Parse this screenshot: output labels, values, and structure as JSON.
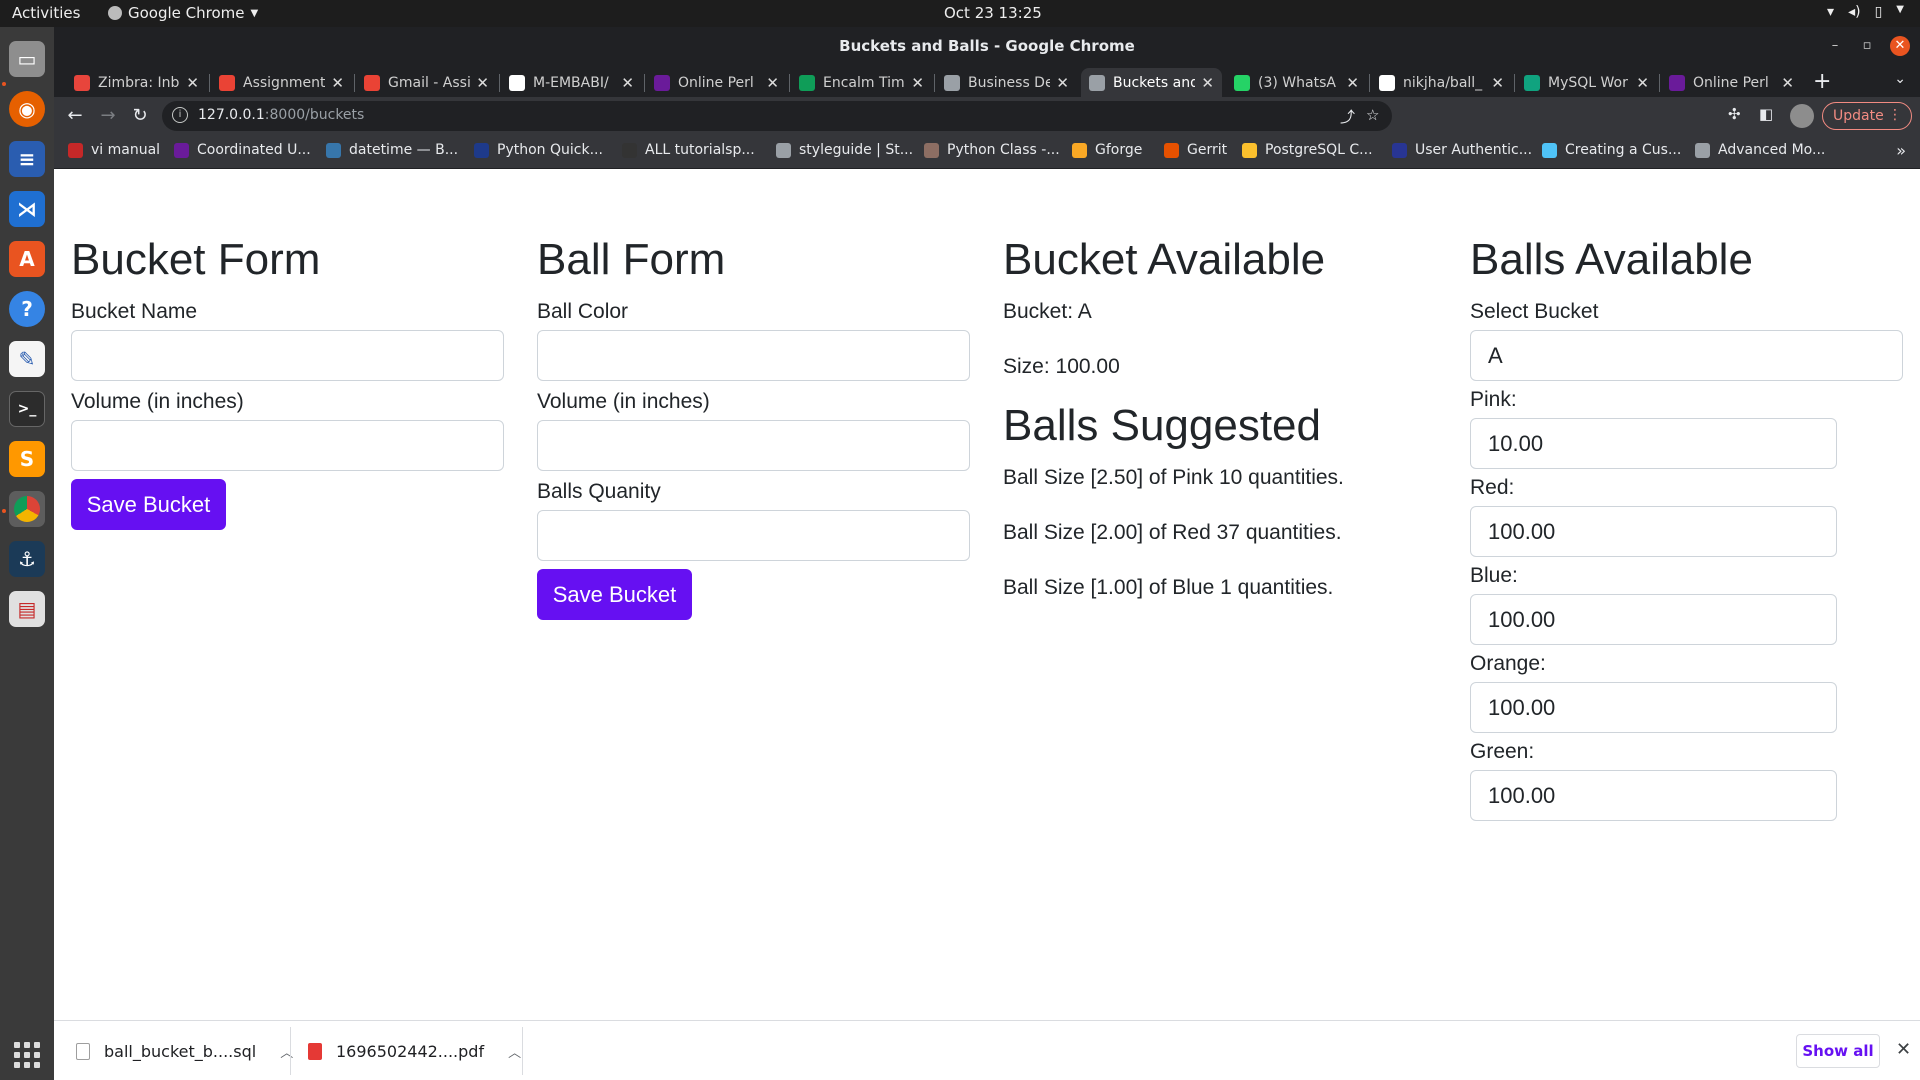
{
  "os": {
    "activities": "Activities",
    "app_menu": "Google Chrome",
    "clock": "Oct 23  13:25"
  },
  "window": {
    "title": "Buckets and Balls - Google Chrome"
  },
  "tabs": [
    {
      "label": "Zimbra: Inb",
      "icon": "zimbra-icon",
      "color": "#e8453c"
    },
    {
      "label": "Assignment",
      "icon": "gmail-icon",
      "color": "#ea4335"
    },
    {
      "label": "Gmail - Assi",
      "icon": "gmail-icon",
      "color": "#ea4335"
    },
    {
      "label": "M-EMBABI/",
      "icon": "github-icon",
      "color": "#ffffff"
    },
    {
      "label": "Online Perl",
      "icon": "onecompiler-icon",
      "color": "#6a1b9a"
    },
    {
      "label": "Encalm Tim",
      "icon": "sheets-icon",
      "color": "#0f9d58"
    },
    {
      "label": "Business De",
      "icon": "globe-icon",
      "color": "#9aa0a6"
    },
    {
      "label": "Buckets and",
      "icon": "globe-icon",
      "color": "#9aa0a6",
      "active": true
    },
    {
      "label": "(3) WhatsA",
      "icon": "whatsapp-icon",
      "color": "#25d366"
    },
    {
      "label": "nikjha/ball_",
      "icon": "github-icon",
      "color": "#ffffff"
    },
    {
      "label": "MySQL Wor",
      "icon": "chatgpt-icon",
      "color": "#10a37f"
    },
    {
      "label": "Online Perl",
      "icon": "onecompiler-icon",
      "color": "#6a1b9a"
    }
  ],
  "address_bar": {
    "host": "127.0.0.1",
    "path": ":8000/buckets"
  },
  "update_label": "Update",
  "bookmarks": [
    {
      "label": "vi manual",
      "icon": "bookmark-s-icon",
      "color": "#c62828"
    },
    {
      "label": "Coordinated U...",
      "icon": "bookmark-cu-icon",
      "color": "#6a1b9a"
    },
    {
      "label": "datetime — B...",
      "icon": "python-icon",
      "color": "#3776ab"
    },
    {
      "label": "Python Quick...",
      "icon": "bookmark-play-icon",
      "color": "#1e3a8a"
    },
    {
      "label": "ALL tutorialsp...",
      "icon": "bookmark-grid-icon",
      "color": "#333333"
    },
    {
      "label": "styleguide | St...",
      "icon": "globe-icon",
      "color": "#9aa0a6"
    },
    {
      "label": "Python Class -...",
      "icon": "bookmark-w3-icon",
      "color": "#8d6e63"
    },
    {
      "label": "Gforge",
      "icon": "gforge-icon",
      "color": "#f9a825"
    },
    {
      "label": "Gerrit",
      "icon": "gerrit-icon",
      "color": "#e65100"
    },
    {
      "label": "PostgreSQL C...",
      "icon": "postgresql-icon",
      "color": "#fbc02d"
    },
    {
      "label": "User Authentic...",
      "icon": "bookmark-user-icon",
      "color": "#283593"
    },
    {
      "label": "Creating a Cus...",
      "icon": "bookmark-cube-icon",
      "color": "#4fc3f7"
    },
    {
      "label": "Advanced Mo...",
      "icon": "globe-icon",
      "color": "#9aa0a6"
    }
  ],
  "bucket_form": {
    "title": "Bucket Form",
    "name_label": "Bucket Name",
    "volume_label": "Volume (in inches)",
    "save_label": "Save Bucket"
  },
  "ball_form": {
    "title": "Ball Form",
    "color_label": "Ball Color",
    "volume_label": "Volume (in inches)",
    "quantity_label": "Balls Quanity",
    "save_label": "Save Bucket"
  },
  "bucket_available": {
    "title": "Bucket Available",
    "bucket_line": "Bucket: A",
    "size_line": "Size: 100.00"
  },
  "balls_suggested": {
    "title": "Balls Suggested",
    "lines": [
      "Ball Size [2.50] of Pink 10 quantities.",
      "Ball Size [2.00] of Red 37 quantities.",
      "Ball Size [1.00] of Blue 1 quantities."
    ]
  },
  "balls_available": {
    "title": "Balls Available",
    "select_label": "Select Bucket",
    "selected_bucket": "A",
    "colors": [
      {
        "label": "Pink:",
        "value": "10.00"
      },
      {
        "label": "Red:",
        "value": "100.00"
      },
      {
        "label": "Blue:",
        "value": "100.00"
      },
      {
        "label": "Orange:",
        "value": "100.00"
      },
      {
        "label": "Green:",
        "value": "100.00"
      }
    ]
  },
  "downloads": {
    "items": [
      {
        "name": "ball_bucket_b....sql",
        "icon": "file-icon",
        "color": "#9e9e9e"
      },
      {
        "name": "1696502442....pdf",
        "icon": "pdf-icon",
        "color": "#e53935"
      }
    ],
    "show_all": "Show all"
  },
  "colors": {
    "primary_button": "#6610f2"
  }
}
